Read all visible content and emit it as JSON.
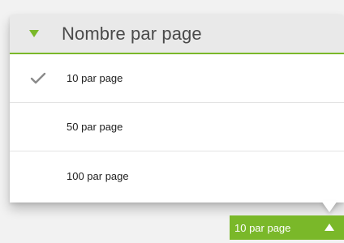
{
  "dropdown": {
    "title": "Nombre par page",
    "header_icon": "caret-down-icon",
    "options": [
      {
        "label": "10 par page",
        "selected": true
      },
      {
        "label": "50 par page",
        "selected": false
      },
      {
        "label": "100 par page",
        "selected": false
      }
    ],
    "check_icon": "checkmark-icon"
  },
  "trigger": {
    "label": "10 par page",
    "icon": "caret-up-icon"
  },
  "colors": {
    "accent": "#7ab829",
    "header_bg": "#e9e9e9",
    "panel_bg": "#ffffff",
    "check": "#8a8a8a"
  }
}
